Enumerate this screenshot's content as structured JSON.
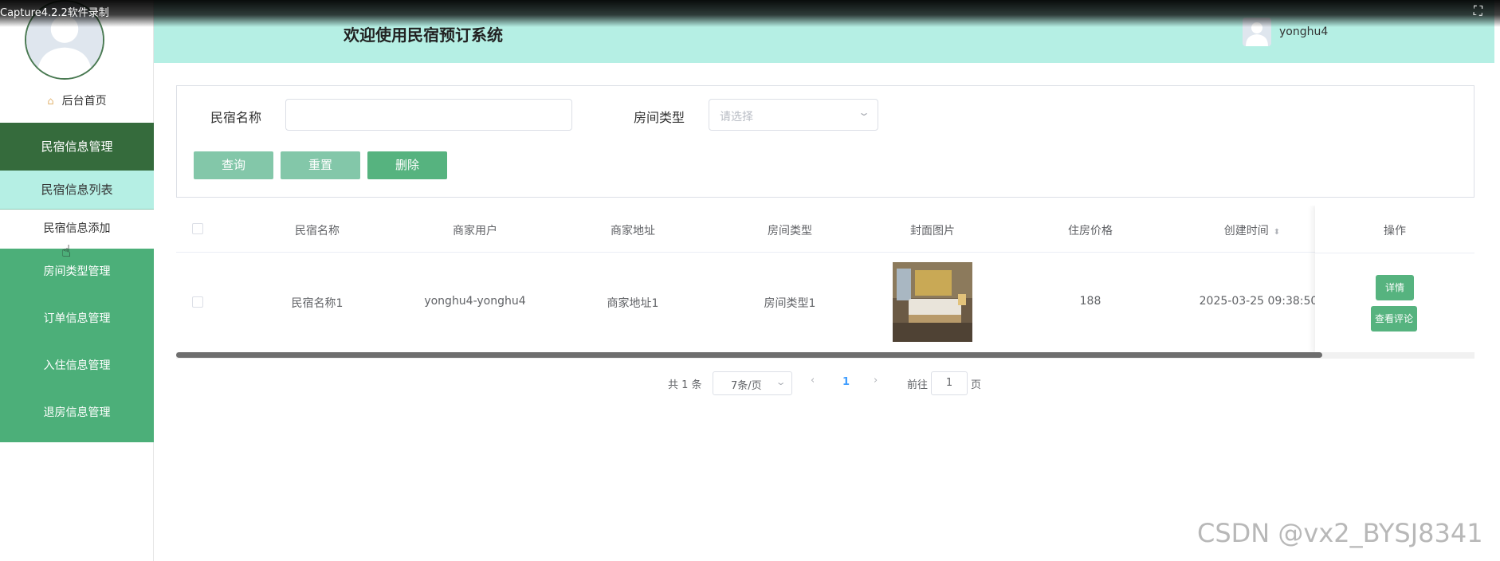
{
  "capture": {
    "label": "Capture4.2.2软件录制",
    "icon": "exit-fullscreen-icon"
  },
  "header": {
    "title": "欢迎使用民宿预订系统",
    "username": "yonghu4"
  },
  "sidebar": {
    "home": "后台首页",
    "menu": {
      "group_active": "民宿信息管理",
      "sub_items": [
        "民宿信息列表",
        "民宿信息添加"
      ],
      "groups": [
        "房间类型管理",
        "订单信息管理",
        "入住信息管理",
        "退房信息管理"
      ]
    }
  },
  "search": {
    "name_label": "民宿名称",
    "name_value": "",
    "type_label": "房间类型",
    "type_placeholder": "请选择",
    "buttons": {
      "query": "查询",
      "reset": "重置",
      "delete": "删除"
    }
  },
  "table": {
    "columns": [
      "民宿名称",
      "商家用户",
      "商家地址",
      "房间类型",
      "封面图片",
      "住房价格",
      "创建时间",
      "操作"
    ],
    "rows": [
      {
        "name": "民宿名称1",
        "merchant_user": "yonghu4-yonghu4",
        "merchant_address": "商家地址1",
        "room_type": "房间类型1",
        "price": "188",
        "created": "2025-03-25 09:38:50",
        "actions": [
          "详情",
          "查看评论"
        ]
      }
    ]
  },
  "pagination": {
    "total": "共 1 条",
    "page_size": "7条/页",
    "current_page": "1",
    "goto_label": "前往",
    "goto_value": "1",
    "page_suffix": "页"
  },
  "watermark": "CSDN @vx2_BYSJ8341"
}
